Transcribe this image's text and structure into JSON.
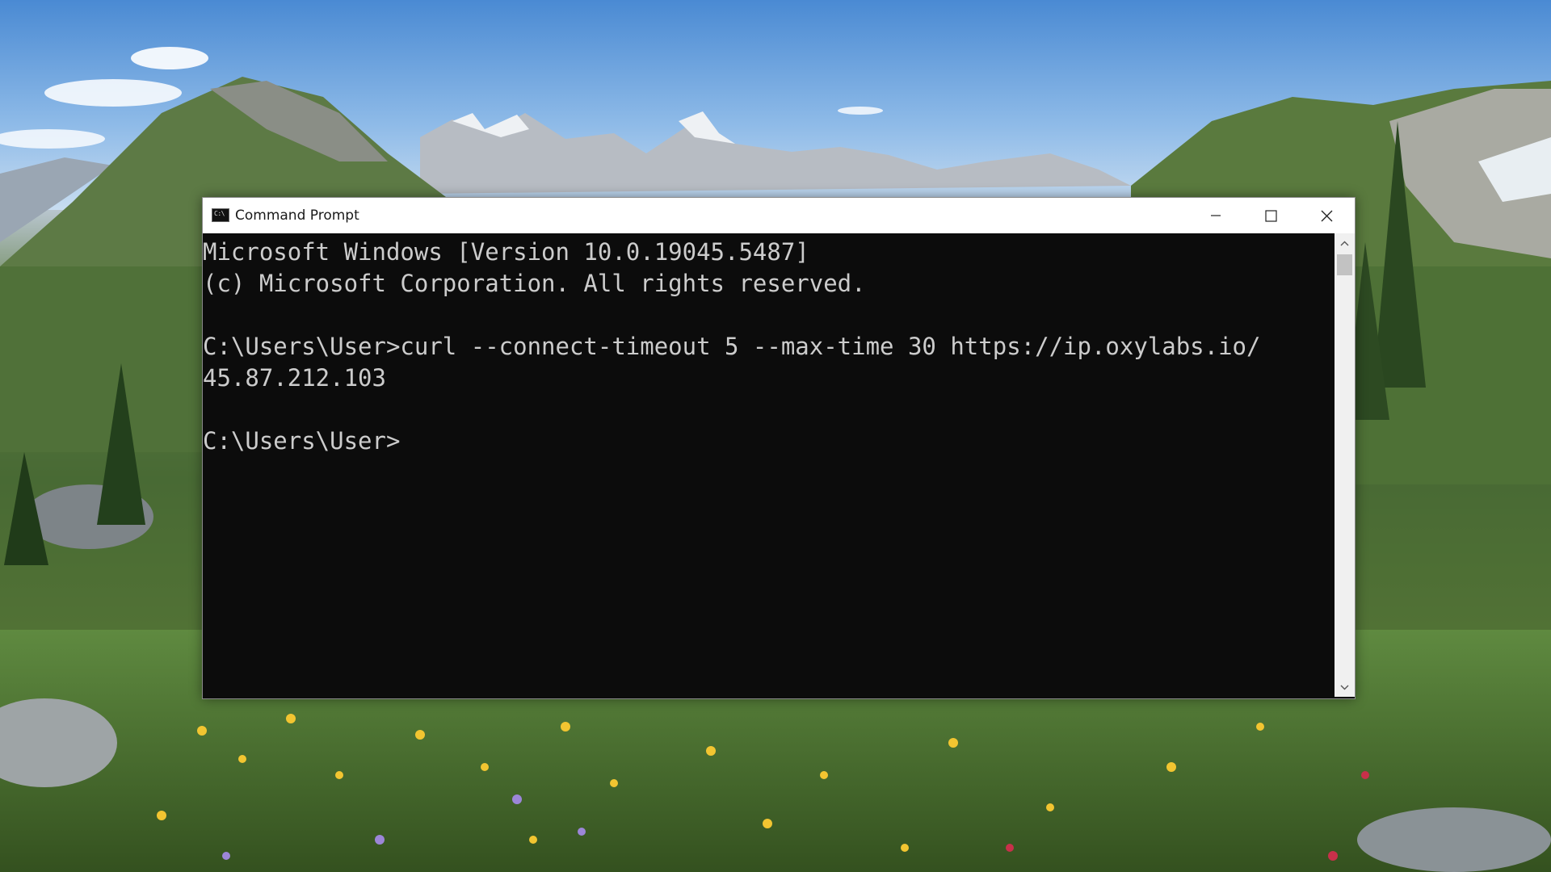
{
  "window": {
    "title": "Command Prompt",
    "icon": "cmd-app-icon",
    "icon_text": "C:\\",
    "controls": {
      "minimize_icon": "minimize-icon",
      "maximize_icon": "maximize-icon",
      "close_icon": "close-icon"
    }
  },
  "console": {
    "lines": [
      "Microsoft Windows [Version 10.0.19045.5487]",
      "(c) Microsoft Corporation. All rights reserved.",
      "",
      "C:\\Users\\User>curl --connect-timeout 5 --max-time 30 https://ip.oxylabs.io/",
      "45.87.212.103",
      "",
      "C:\\Users\\User>"
    ],
    "background_color": "#0c0c0c",
    "text_color": "#cccccc"
  },
  "scrollbar": {
    "up_icon": "chevron-up-icon",
    "down_icon": "chevron-down-icon"
  },
  "desktop": {
    "wallpaper": "mountain meadow landscape"
  }
}
